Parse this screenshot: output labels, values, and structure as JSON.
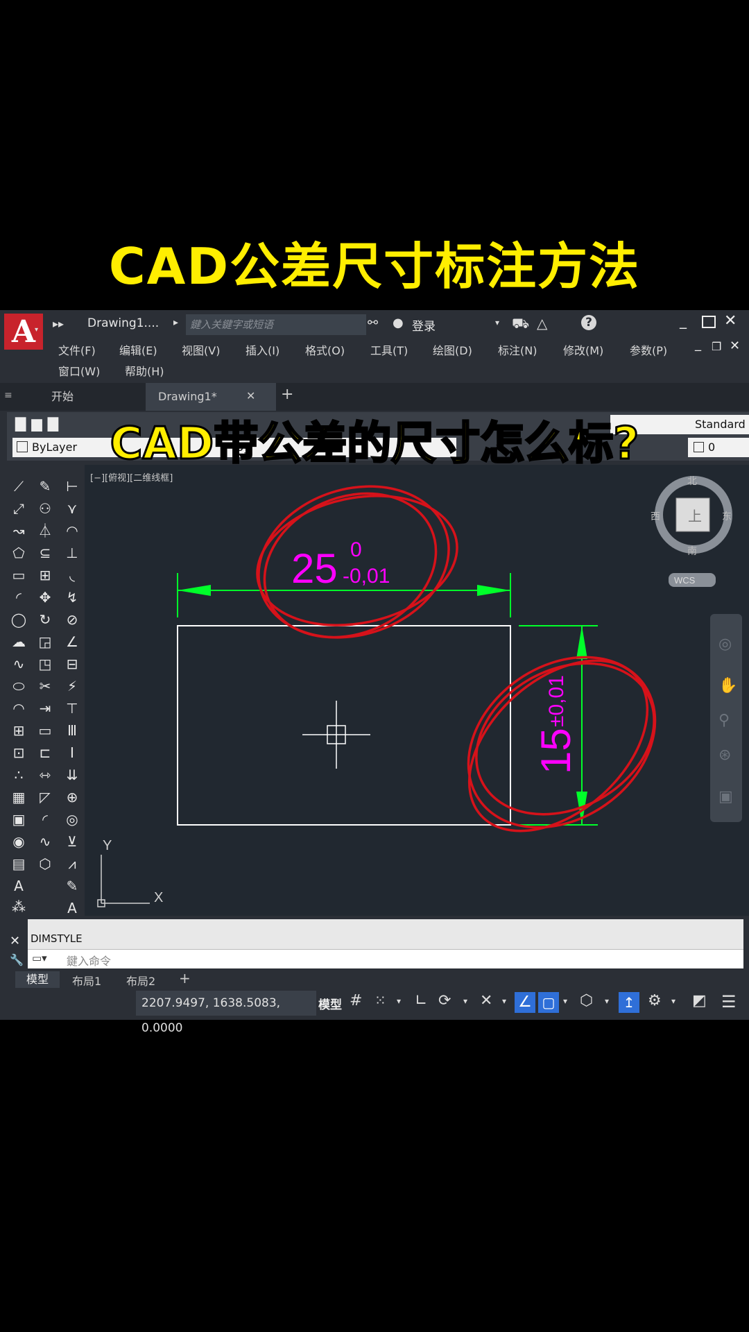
{
  "headline": "CAD公差尺寸标注方法",
  "overlay_question": "CAD带公差的尺寸怎么标?",
  "app": {
    "logo_letter": "A",
    "document_title": "Drawing1....",
    "search_placeholder": "鍵入关鍵字或短语",
    "login_label": "登录",
    "help_icon": "?"
  },
  "menu": {
    "row1": [
      "文件(F)",
      "编辑(E)",
      "视图(V)",
      "插入(I)",
      "格式(O)",
      "工具(T)",
      "绘图(D)",
      "标注(N)",
      "修改(M)",
      "参数(P)"
    ],
    "row2": [
      "窗口(W)",
      "帮助(H)"
    ]
  },
  "tabs": {
    "start": "开始",
    "drawing": "Drawing1*",
    "close": "✕",
    "add": "+"
  },
  "toolbar": {
    "layer": "ByLayer",
    "layer2": "By",
    "style": "Standard",
    "layer_num": "0"
  },
  "viewport": {
    "label": "[−][俯视][二维线框]",
    "dim_top_main": "25",
    "dim_top_upper": "0",
    "dim_top_lower": "-0,01",
    "dim_right_main": "15",
    "dim_right_tol": "±0,01",
    "compass_center": "上",
    "compass_n": "北",
    "compass_s": "南",
    "compass_e": "东",
    "compass_w": "西",
    "wcs": "WCS",
    "axis_x": "X",
    "axis_y": "Y",
    "colors": {
      "dimension": "#00ff2a",
      "text": "#ff00ff",
      "circle": "#d6121a",
      "lines": "#ffffff"
    }
  },
  "command": {
    "history": "DIMSTYLE",
    "prompt": "鍵入命令"
  },
  "layout_tabs": [
    "模型",
    "布局1",
    "布局2",
    "+"
  ],
  "status": {
    "coords": "2207.9497, 1638.5083, 0.0000",
    "model": "模型"
  }
}
